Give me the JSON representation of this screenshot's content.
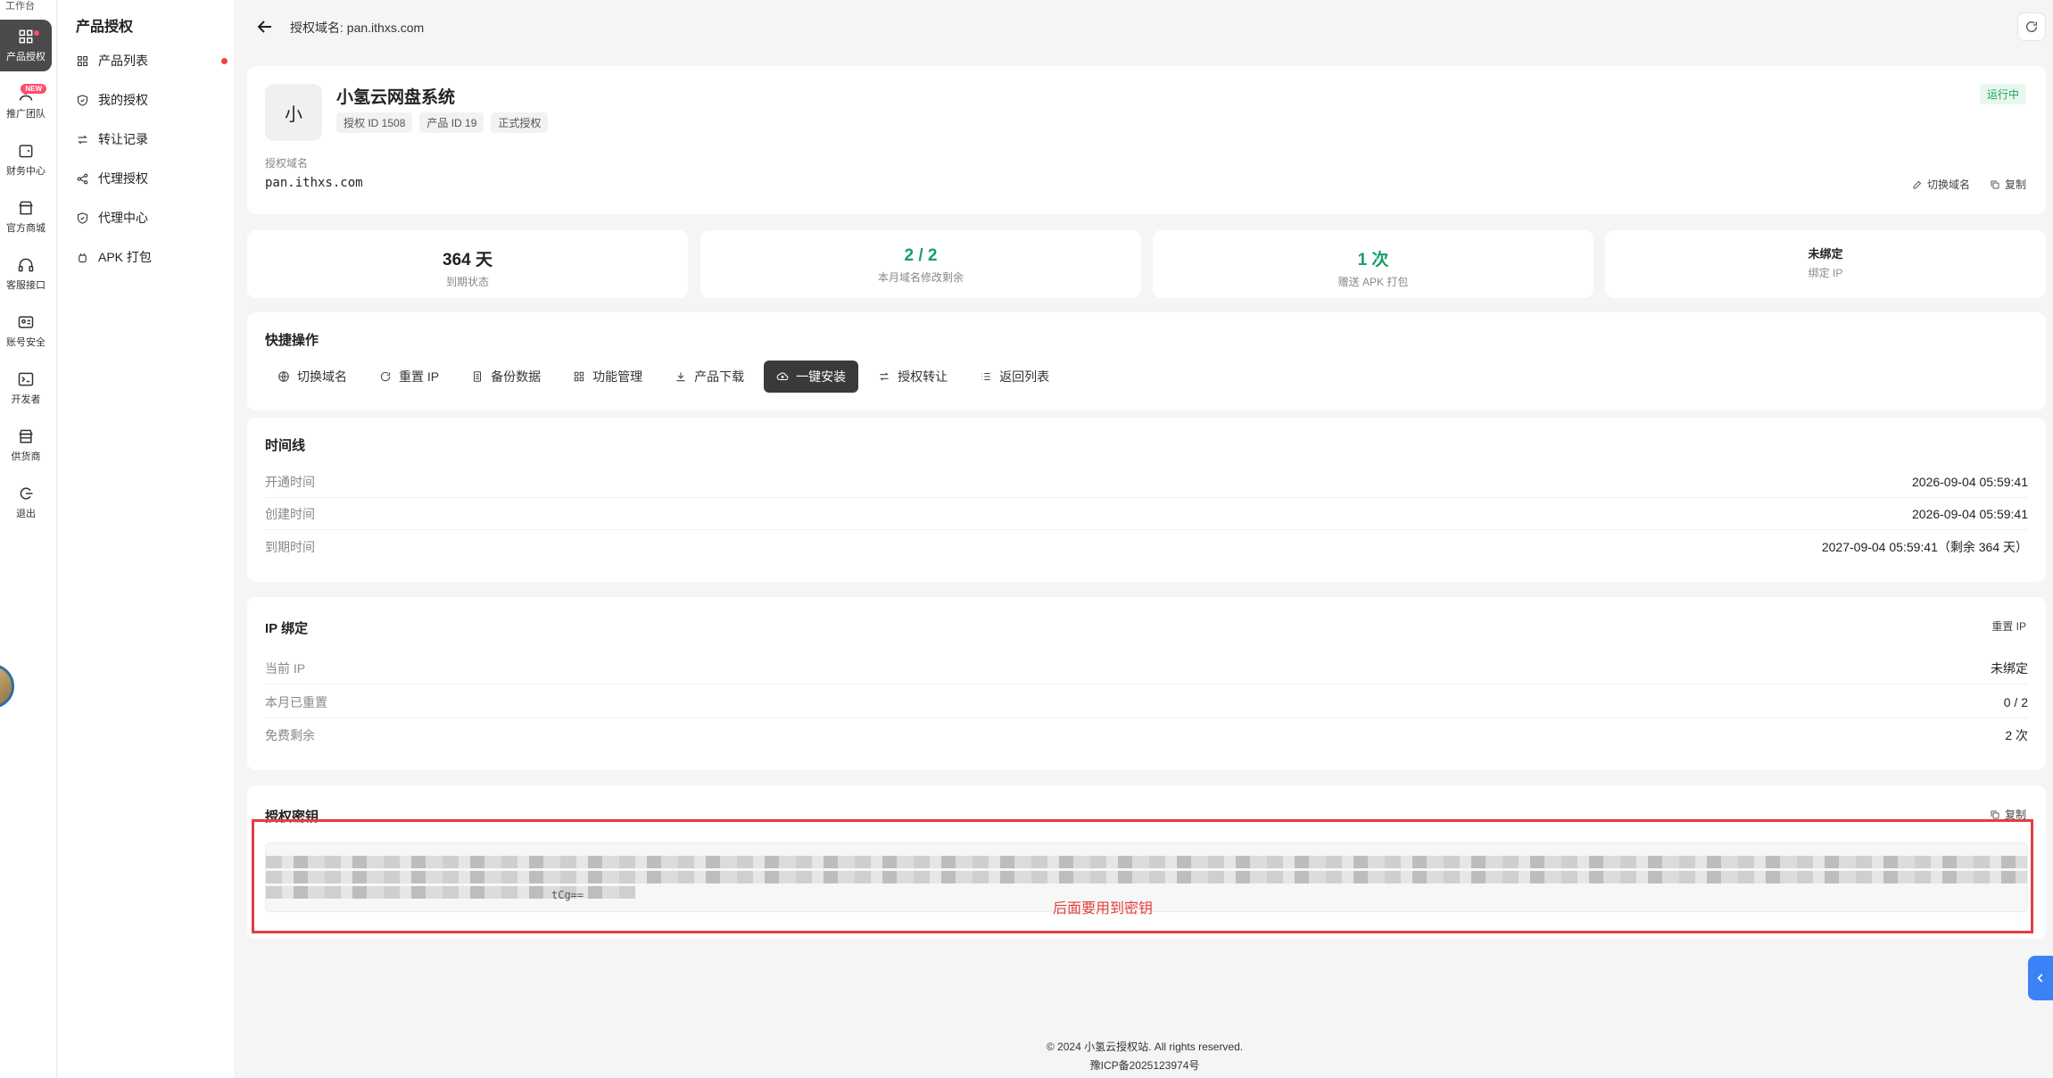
{
  "rail": {
    "top_label": "工作台",
    "items": [
      {
        "label": "产品授权",
        "icon": "grid-icon"
      },
      {
        "label": "推广团队",
        "icon": "team-icon",
        "badge": "NEW"
      },
      {
        "label": "财务中心",
        "icon": "wallet-icon"
      },
      {
        "label": "官方商城",
        "icon": "store-icon"
      },
      {
        "label": "客服接口",
        "icon": "headset-icon"
      },
      {
        "label": "账号安全",
        "icon": "id-card-icon"
      },
      {
        "label": "开发者",
        "icon": "terminal-icon"
      },
      {
        "label": "供货商",
        "icon": "supplier-icon"
      },
      {
        "label": "退出",
        "icon": "logout-icon"
      }
    ]
  },
  "sidebar": {
    "title": "产品授权",
    "items": [
      {
        "label": "产品列表",
        "icon": "grid-icon"
      },
      {
        "label": "我的授权",
        "icon": "shield-icon"
      },
      {
        "label": "转让记录",
        "icon": "transfer-icon"
      },
      {
        "label": "代理授权",
        "icon": "share-icon"
      },
      {
        "label": "代理中心",
        "icon": "shield-check-icon"
      },
      {
        "label": "APK 打包",
        "icon": "android-icon"
      }
    ]
  },
  "header": {
    "title": "授权域名: pan.ithxs.com"
  },
  "product": {
    "logo_char": "小",
    "name": "小氢云网盘系统",
    "tags": [
      "授权 ID 1508",
      "产品 ID 19",
      "正式授权"
    ],
    "status": "运行中",
    "domain_label": "授权域名",
    "domain": "pan.ithxs.com",
    "switch_label": "切换域名",
    "copy_label": "复制"
  },
  "stats": [
    {
      "value": "364 天",
      "label": "到期状态"
    },
    {
      "value": "2 / 2",
      "label": "本月域名修改剩余"
    },
    {
      "value": "1 次",
      "label": "赠送 APK 打包"
    },
    {
      "value": "未绑定",
      "label": "绑定 IP"
    }
  ],
  "quick": {
    "title": "快捷操作",
    "actions": [
      {
        "label": "切换域名",
        "icon": "globe-icon"
      },
      {
        "label": "重置 IP",
        "icon": "reset-icon"
      },
      {
        "label": "备份数据",
        "icon": "file-icon"
      },
      {
        "label": "功能管理",
        "icon": "grid-icon"
      },
      {
        "label": "产品下载",
        "icon": "download-icon"
      },
      {
        "label": "一键安装",
        "icon": "cloud-upload-icon"
      },
      {
        "label": "授权转让",
        "icon": "transfer-icon"
      },
      {
        "label": "返回列表",
        "icon": "list-icon"
      }
    ]
  },
  "timeline": {
    "title": "时间线",
    "rows": [
      {
        "k": "开通时间",
        "v": "2026-09-04 05:59:41"
      },
      {
        "k": "创建时间",
        "v": "2026-09-04 05:59:41"
      },
      {
        "k": "到期时间",
        "v": "2027-09-04 05:59:41（剩余 364 天）"
      }
    ]
  },
  "ip": {
    "title": "IP 绑定",
    "reset_label": "重置 IP",
    "rows": [
      {
        "k": "当前 IP",
        "v": "未绑定"
      },
      {
        "k": "本月已重置",
        "v": "0 / 2"
      },
      {
        "k": "免费剩余",
        "v": "2 次"
      }
    ]
  },
  "key": {
    "title": "授权密钥",
    "copy_label": "复制",
    "tail": "tCg==",
    "annotation": "后面要用到密钥"
  },
  "footer": {
    "copyright": "© 2024 小氢云授权站. All rights reserved.",
    "icp": "豫ICP备2025123974号"
  }
}
